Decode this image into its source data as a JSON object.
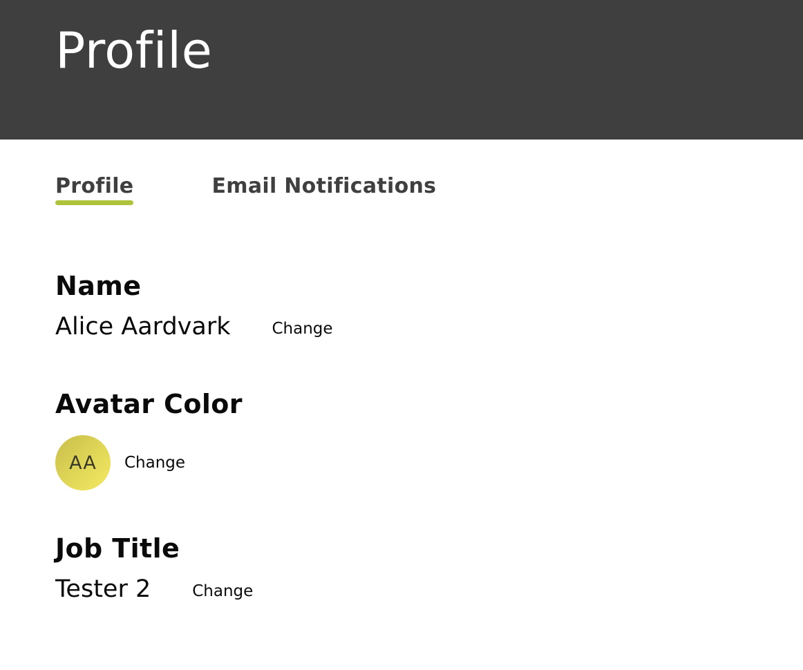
{
  "header": {
    "title": "Profile"
  },
  "tabs": [
    {
      "label": "Profile",
      "active": true
    },
    {
      "label": "Email Notifications",
      "active": false
    }
  ],
  "colors": {
    "header_bg": "#3f3f3f",
    "accent": "#aec23a",
    "avatar": "#e6dc58"
  },
  "name_section": {
    "heading": "Name",
    "value": "Alice Aardvark",
    "change_label": "Change"
  },
  "avatar_section": {
    "heading": "Avatar Color",
    "initials": "AA",
    "change_label": "Change"
  },
  "job_section": {
    "heading": "Job Title",
    "value": "Tester 2",
    "change_label": "Change"
  }
}
